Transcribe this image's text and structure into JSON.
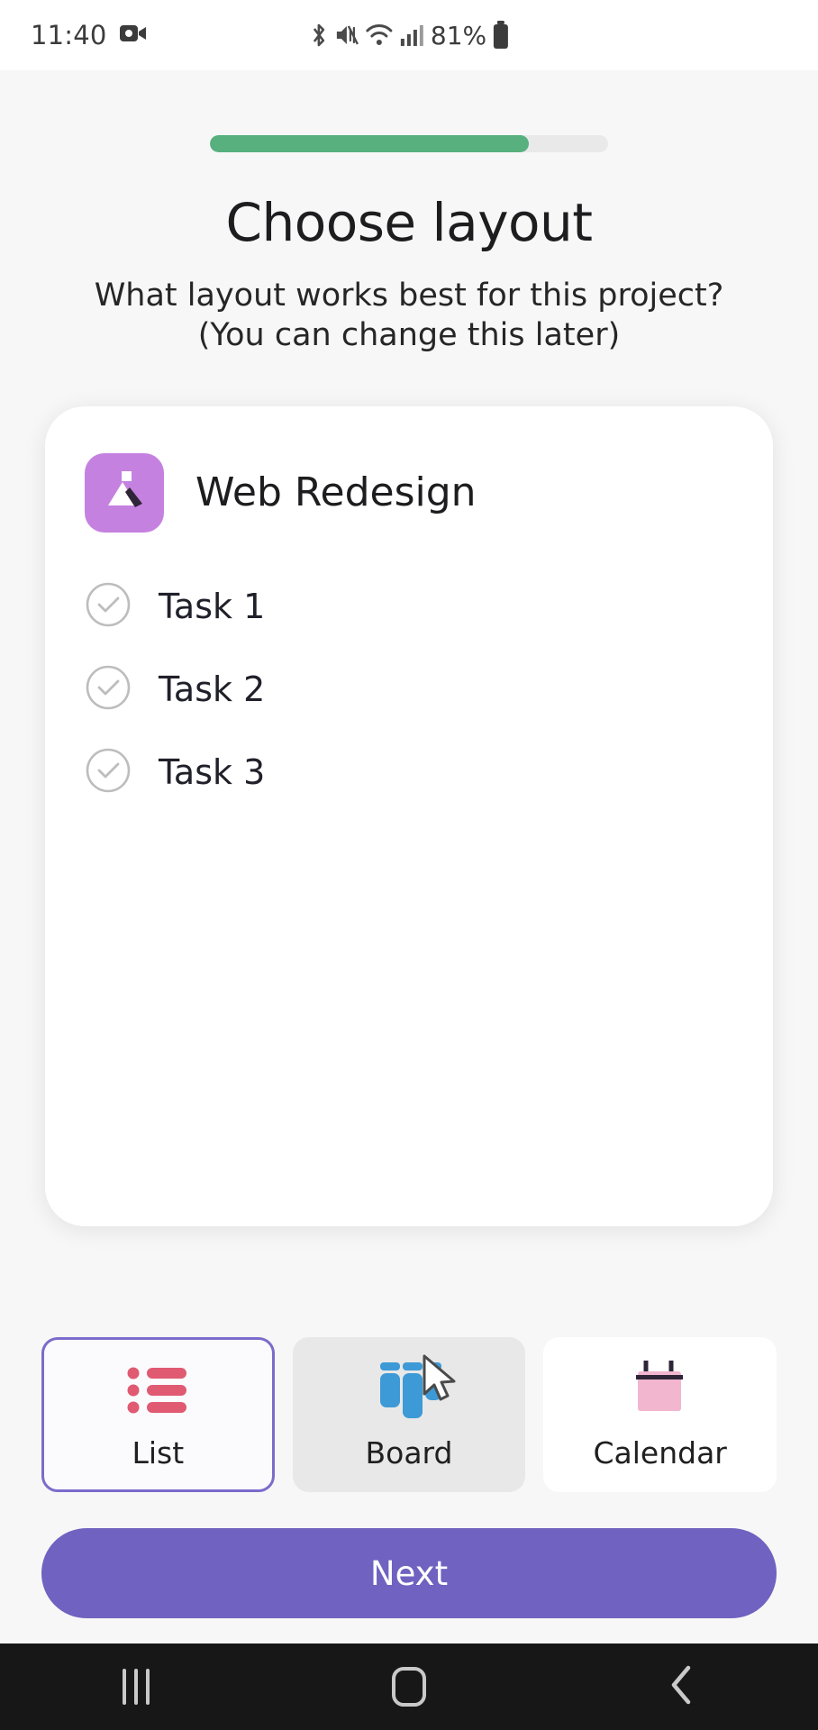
{
  "status_bar": {
    "time": "11:40",
    "battery_percent": "81%",
    "icons": [
      "video-record-icon",
      "bluetooth-icon",
      "mute-icon",
      "wifi-icon",
      "signal-icon",
      "battery-icon"
    ]
  },
  "onboarding": {
    "progress_percent": 80,
    "title": "Choose layout",
    "subtitle_line1": "What layout works best for this project?",
    "subtitle_line2": "(You can change this later)"
  },
  "preview": {
    "project_name": "Web Redesign",
    "project_icon": "mountain-icon",
    "tasks": [
      {
        "label": "Task 1",
        "done": false
      },
      {
        "label": "Task 2",
        "done": false
      },
      {
        "label": "Task 3",
        "done": false
      }
    ]
  },
  "layout_options": [
    {
      "id": "list",
      "label": "List",
      "icon": "list-icon",
      "state": "selected"
    },
    {
      "id": "board",
      "label": "Board",
      "icon": "board-icon",
      "state": "hovered"
    },
    {
      "id": "calendar",
      "label": "Calendar",
      "icon": "calendar-icon",
      "state": "default"
    }
  ],
  "primary_action": {
    "label": "Next"
  },
  "nav_bar": {
    "recents": "recents-icon",
    "home": "home-icon",
    "back": "back-icon"
  },
  "colors": {
    "progress_fill": "#57b07e",
    "accent_purple": "#6f62c0",
    "selected_border": "#7b6ccb",
    "app_icon_bg": "#c581e0",
    "list_icon": "#e05a72",
    "board_icon": "#3d9ad6",
    "calendar_icon": "#f2b6cf"
  }
}
